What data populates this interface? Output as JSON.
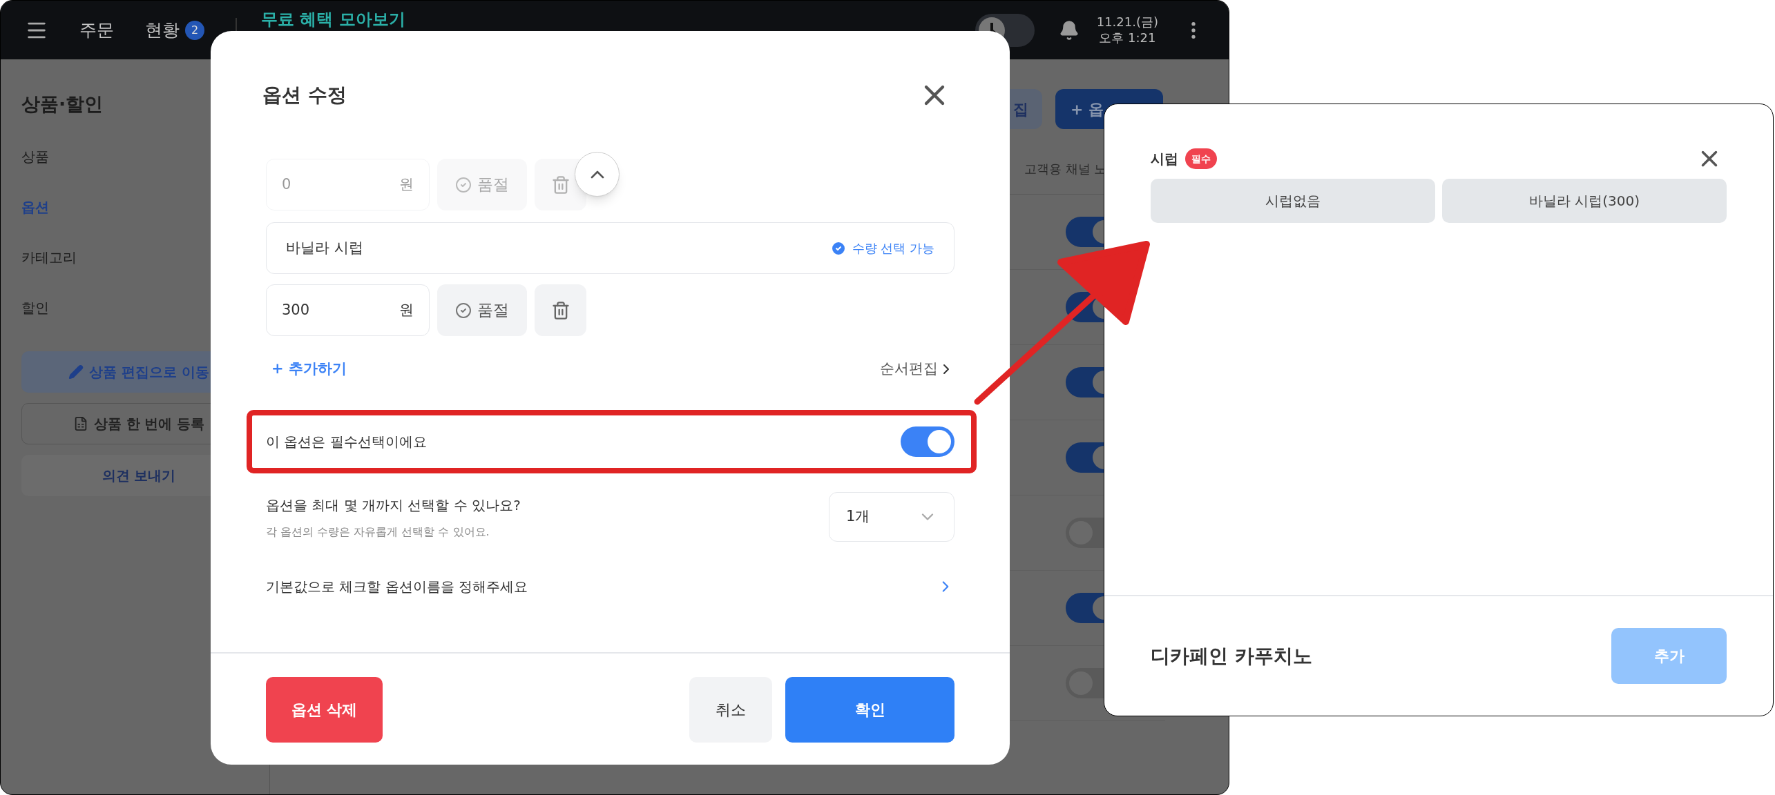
{
  "app_bar": {
    "nav": [
      {
        "label": "주문"
      },
      {
        "label": "현황",
        "badge": "2"
      }
    ],
    "banner_link": "무료 혜택 모아보기",
    "theme_toggle": {
      "on": false
    },
    "date": "11.21.(금)",
    "time": "오후 1:21"
  },
  "sidebar": {
    "title": "상품·할인",
    "items": [
      {
        "label": "상품",
        "selected": false
      },
      {
        "label": "옵션",
        "selected": true
      },
      {
        "label": "카테고리",
        "selected": false
      },
      {
        "label": "할인",
        "selected": false
      }
    ],
    "buttons": [
      {
        "label": "상품 편집으로 이동",
        "kind": "edit"
      },
      {
        "label": "상품 한 번에 등록",
        "kind": "bulk"
      },
      {
        "label": "의견 보내기",
        "kind": "plain"
      }
    ]
  },
  "main": {
    "buttons": [
      {
        "label": "집",
        "kind": "secondary"
      },
      {
        "label": "+ 옵",
        "kind": "primary"
      }
    ],
    "column_header": "고객용 채널 노",
    "rows": [
      {
        "on": true
      },
      {
        "on": true
      },
      {
        "on": true
      },
      {
        "on": true
      },
      {
        "on": false
      },
      {
        "on": true
      },
      {
        "on": false
      }
    ]
  },
  "modal": {
    "title": "옵션 수정",
    "options": [
      {
        "price": "0",
        "currency": "원",
        "soldout": "품절"
      },
      {
        "name": "바닐라 시럽",
        "quantity_label": "수량 선택 가능",
        "quantity_checked": true,
        "price": "300",
        "currency": "원",
        "soldout": "품절"
      }
    ],
    "add_label": "+ 추가하기",
    "reorder_label": "순서편집",
    "required": {
      "label": "이 옵션은 필수선택이에요",
      "on": true
    },
    "max_select": {
      "label": "옵션을 최대 몇 개까지 선택할 수 있나요?",
      "help": "각 옵션의 수량은 자유롭게 선택할 수 있어요.",
      "value": "1개"
    },
    "default_label": "기본값으로 체크할 옵션이름을 정해주세요",
    "buttons": {
      "delete": "옵션 삭제",
      "cancel": "취소",
      "confirm": "확인"
    }
  },
  "popup": {
    "group": "시럽",
    "badge": "필수",
    "choices": [
      {
        "label": "시럽없음",
        "selected": false
      },
      {
        "label": "바닐라 시럽(300)",
        "selected": false
      }
    ],
    "product": "디카페인 카푸치노",
    "add_button": {
      "label": "추가",
      "disabled": true
    }
  }
}
